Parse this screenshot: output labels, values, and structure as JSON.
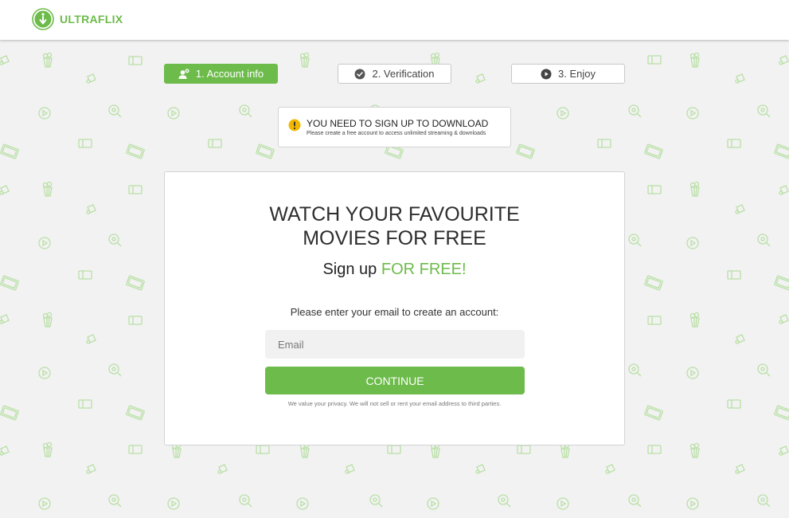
{
  "header": {
    "logo_text": "ULTRAFLIX"
  },
  "steps": [
    {
      "label": "1. Account info",
      "icon": "user-add-icon",
      "active": true
    },
    {
      "label": "2. Verification",
      "icon": "check-circle-icon",
      "active": false
    },
    {
      "label": "3. Enjoy",
      "icon": "play-circle-icon",
      "active": false
    }
  ],
  "notice": {
    "title": "YOU NEED TO SIGN UP TO DOWNLOAD",
    "subtitle": "Please create a free account to access unlimited streaming & downloads",
    "icon": "warning-icon"
  },
  "signup": {
    "headline_line1": "WATCH YOUR FAVOURITE",
    "headline_line2": "MOVIES FOR FREE",
    "subhead_prefix": "Sign up",
    "subhead_highlight": "FOR FREE!",
    "prompt": "Please enter your email to create an account:",
    "email_placeholder": "Email",
    "continue_label": "CONTINUE",
    "privacy_note": "We value your privacy. We will not sell or rent your email address to third parties."
  },
  "colors": {
    "accent": "#6dbb4b",
    "background": "#f2f2f2",
    "warning": "#f2b800"
  }
}
